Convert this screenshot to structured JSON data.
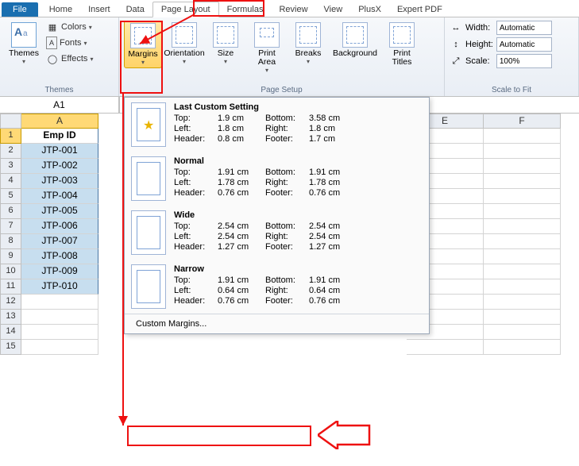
{
  "tabs": {
    "file": "File",
    "items": [
      "Home",
      "Insert",
      "Data",
      "Page Layout",
      "Formulas",
      "Review",
      "View",
      "PlusX",
      "Expert PDF"
    ],
    "active": "Page Layout"
  },
  "ribbon": {
    "themes": {
      "label": "Themes",
      "btn": "Themes",
      "colors": "Colors",
      "fonts": "Fonts",
      "effects": "Effects"
    },
    "pagesetup": {
      "label": "Page Setup",
      "margins": "Margins",
      "orientation": "Orientation",
      "size": "Size",
      "printarea": "Print\nArea",
      "breaks": "Breaks",
      "background": "Background",
      "printtitles": "Print\nTitles"
    },
    "scale": {
      "label": "Scale to Fit",
      "width": "Width:",
      "width_v": "Automatic",
      "height": "Height:",
      "height_v": "Automatic",
      "scale": "Scale:",
      "scale_v": "100%"
    }
  },
  "namebox": "A1",
  "columns": [
    "A",
    "E",
    "F"
  ],
  "data_header": "Emp ID",
  "data": [
    "JTP-001",
    "JTP-002",
    "JTP-003",
    "JTP-004",
    "JTP-005",
    "JTP-006",
    "JTP-007",
    "JTP-008",
    "JTP-009",
    "JTP-010"
  ],
  "blank_rows": [
    12,
    13,
    14,
    15
  ],
  "menu": {
    "presets": [
      {
        "title": "Last Custom Setting",
        "thumb": "star",
        "rows": [
          [
            "Top:",
            "1.9 cm",
            "Bottom:",
            "3.58 cm"
          ],
          [
            "Left:",
            "1.8 cm",
            "Right:",
            "1.8 cm"
          ],
          [
            "Header:",
            "0.8 cm",
            "Footer:",
            "1.7 cm"
          ]
        ]
      },
      {
        "title": "Normal",
        "thumb": "normal",
        "rows": [
          [
            "Top:",
            "1.91 cm",
            "Bottom:",
            "1.91 cm"
          ],
          [
            "Left:",
            "1.78 cm",
            "Right:",
            "1.78 cm"
          ],
          [
            "Header:",
            "0.76 cm",
            "Footer:",
            "0.76 cm"
          ]
        ]
      },
      {
        "title": "Wide",
        "thumb": "wide",
        "rows": [
          [
            "Top:",
            "2.54 cm",
            "Bottom:",
            "2.54 cm"
          ],
          [
            "Left:",
            "2.54 cm",
            "Right:",
            "2.54 cm"
          ],
          [
            "Header:",
            "1.27 cm",
            "Footer:",
            "1.27 cm"
          ]
        ]
      },
      {
        "title": "Narrow",
        "thumb": "narrow",
        "rows": [
          [
            "Top:",
            "1.91 cm",
            "Bottom:",
            "1.91 cm"
          ],
          [
            "Left:",
            "0.64 cm",
            "Right:",
            "0.64 cm"
          ],
          [
            "Header:",
            "0.76 cm",
            "Footer:",
            "0.76 cm"
          ]
        ]
      }
    ],
    "custom": "Custom Margins..."
  }
}
